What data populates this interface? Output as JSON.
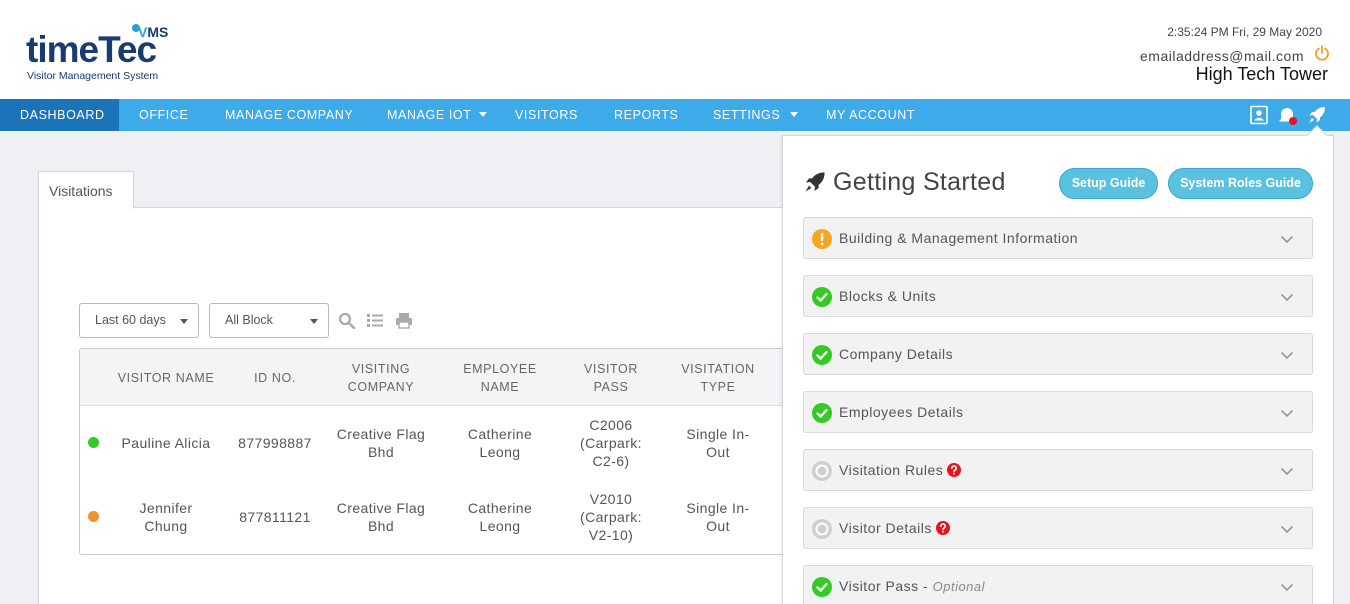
{
  "header": {
    "logo": {
      "brand_time": "time",
      "brand_tec": "Tec",
      "vms": "MS",
      "vms_v": "V",
      "tagline": "Visitor Management System"
    },
    "datetime": "2:35:24 PM  Fri, 29 May 2020",
    "email": "emailaddress@mail.com",
    "building": "High Tech Tower"
  },
  "nav": {
    "items": [
      {
        "label": "DASHBOARD"
      },
      {
        "label": "OFFICE"
      },
      {
        "label": "MANAGE COMPANY"
      },
      {
        "label": "MANAGE IOT"
      },
      {
        "label": "VISITORS"
      },
      {
        "label": "REPORTS"
      },
      {
        "label": "SETTINGS"
      },
      {
        "label": "MY ACCOUNT"
      }
    ],
    "icons": [
      "contact-card-icon",
      "bell-icon",
      "rocket-icon"
    ],
    "active_color": "#1c74b8",
    "bar_color": "#3daaea"
  },
  "main": {
    "tab": "Visitations",
    "filters": {
      "date_range": "Last 60 days",
      "block": "All Block"
    },
    "toolbar_icons": [
      "search-icon",
      "list-icon",
      "print-icon"
    ],
    "table": {
      "columns": [
        "VISITOR NAME",
        "ID NO.",
        "VISITING COMPANY",
        "EMPLOYEE NAME",
        "VISITOR PASS",
        "VISITATION TYPE"
      ],
      "rows": [
        {
          "status_color": "#34c924",
          "visitor": "Pauline Alicia",
          "id": "877998887",
          "company": "Creative Flag Bhd",
          "employee": "Catherine Leong",
          "pass": "C2006 (Carpark: C2-6)",
          "type": "Single In-Out"
        },
        {
          "status_color": "#f0932a",
          "visitor": "Jennifer Chung",
          "id": "877811121",
          "company": "Creative Flag Bhd",
          "employee": "Catherine Leong",
          "pass": "V2010 (Carpark: V2-10)",
          "type": "Single In-Out"
        }
      ]
    }
  },
  "getting_started": {
    "title": "Getting Started",
    "setup_guide": "Setup Guide",
    "roles_guide": "System Roles Guide",
    "sections": [
      {
        "label": "Building & Management Information",
        "status": "warning",
        "help": false,
        "optional": ""
      },
      {
        "label": "Blocks & Units",
        "status": "done",
        "help": false,
        "optional": ""
      },
      {
        "label": "Company Details",
        "status": "done",
        "help": false,
        "optional": ""
      },
      {
        "label": "Employees Details",
        "status": "done",
        "help": false,
        "optional": ""
      },
      {
        "label": "Visitation Rules",
        "status": "pending",
        "help": true,
        "optional": ""
      },
      {
        "label": "Visitor Details",
        "status": "pending",
        "help": true,
        "optional": ""
      },
      {
        "label": "Visitor Pass - ",
        "status": "done",
        "help": false,
        "optional": "Optional"
      }
    ]
  }
}
